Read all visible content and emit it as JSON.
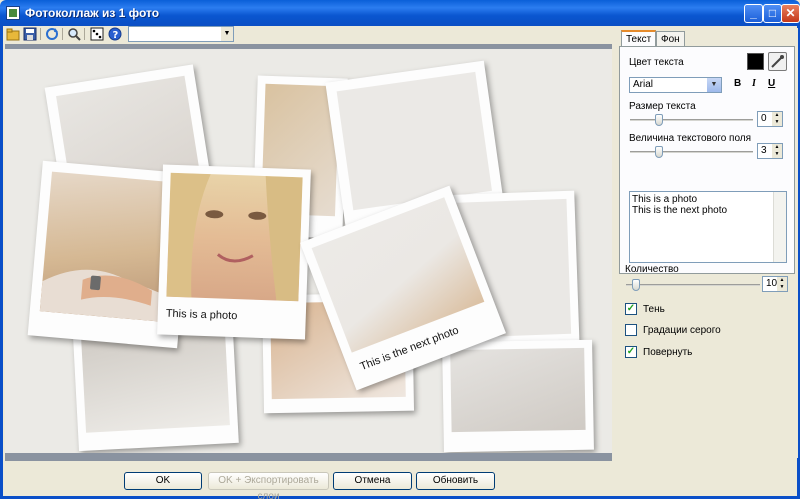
{
  "window": {
    "title": "Фотоколлаж из 1 фото"
  },
  "toolbar": {
    "combo_value": ""
  },
  "canvas": {
    "captions": {
      "first": "This is a photo",
      "second": "This is the next photo"
    }
  },
  "panel": {
    "tabs": [
      {
        "label": "Текст"
      },
      {
        "label": "Фон"
      }
    ],
    "text_color_label": "Цвет текста",
    "text_color": "#000000",
    "font": "Arial",
    "format_buttons": {
      "bold": "B",
      "italic": "I",
      "underline": "U"
    },
    "size_label": "Размер текста",
    "size_value": "0",
    "field_label": "Величина текстового поля",
    "field_value": "3",
    "text_lines": [
      "This is a photo",
      "This is the next photo"
    ],
    "count_label": "Количество",
    "count_value": "10",
    "options": [
      {
        "label": "Тень",
        "checked": true
      },
      {
        "label": "Градации серого",
        "checked": false
      },
      {
        "label": "Повернуть",
        "checked": true
      }
    ]
  },
  "buttons": {
    "ok": "OK",
    "ok_export": "OK + Экспортировать слои",
    "cancel": "Отмена",
    "refresh": "Обновить"
  },
  "colors": {
    "title_bar": "#0a5fd8",
    "accent_tab": "#e68b2c",
    "checkmark": "#21a121"
  }
}
